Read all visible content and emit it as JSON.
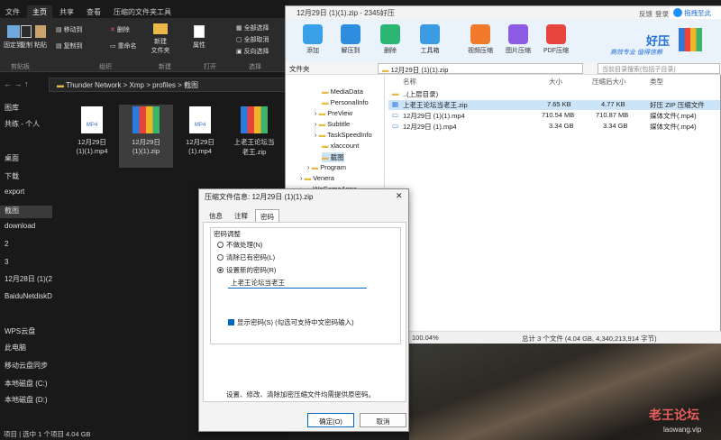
{
  "explorer": {
    "tabs": [
      "文件",
      "主页",
      "共享",
      "查看",
      "压缩的文件夹工具"
    ],
    "ribbon": {
      "btn_pin": "固定到",
      "btn_copy": "复制",
      "btn_paste": "粘贴",
      "move_to": "移动到",
      "copy_to": "复制到",
      "delete": "删除",
      "rename": "重命名",
      "new_folder": "新建\n文件夹",
      "properties": "属性",
      "select_all": "全部选择",
      "select_none": "全部取消",
      "invert": "反向选择",
      "groups": [
        "剪贴板",
        "组织",
        "新建",
        "打开",
        "选择"
      ]
    },
    "address": "Thunder Network  >  Xmp  >  profiles  >  截图",
    "nav": [
      "图库",
      "共练 - 个人",
      "桌面",
      "下载",
      "export",
      "截图",
      "download",
      "2",
      "3",
      "12月28日 (1)(2",
      "BaiduNetdiskD",
      "WPS云盘",
      "此电脑",
      "移动云盘同步",
      "本地磁盘 (C:)",
      "本地磁盘 (D:)"
    ],
    "files": [
      {
        "name": "12月29日\n(1)(1).mp4",
        "type": "MP4"
      },
      {
        "name": "12月29日\n(1)(1).zip",
        "type": "zip"
      },
      {
        "name": "12月29日\n(1).mp4",
        "type": "MP4"
      },
      {
        "name": "上老王论坛当\n老王.zip",
        "type": "zip"
      }
    ],
    "status": "项目  |  选中 1 个项目  4.04 GB"
  },
  "zip": {
    "title": "12月29日 (1)(1).zip - 2345好压",
    "top_links": [
      "反馈",
      "登录"
    ],
    "vip": "拖拽至此",
    "toolbar": [
      "添加",
      "解压到",
      "删除",
      "工具箱",
      "视频压缩",
      "图片压缩",
      "PDF压缩"
    ],
    "brand": "好压",
    "slogan": "高效专业  值得信赖",
    "tree_header": "文件夹",
    "address": "12月29日 (1)(1).zip",
    "search": "当前目录搜索(包括子目录)",
    "tree": [
      "MediaData",
      "PersonalInfo",
      "PreView",
      "Subtitle",
      "TaskSpeedInfo",
      "xlaccount",
      "截图",
      "Program",
      "Venera",
      "WeGameApps"
    ],
    "columns": [
      "名称",
      "大小",
      "压缩后大小",
      "类型"
    ],
    "rows": [
      {
        "name": "..(上层目录)",
        "size": "",
        "csize": "",
        "type": ""
      },
      {
        "name": "上老王论坛当老王.zip",
        "size": "7.65 KB",
        "csize": "4.77 KB",
        "type": "好压 ZIP 压缩文件"
      },
      {
        "name": "12月29日 (1)(1).mp4",
        "size": "710.54 MB",
        "csize": "710.87 MB",
        "type": "媒体文件(.mp4)"
      },
      {
        "name": "12月29日 (1).mp4",
        "size": "3.34 GB",
        "csize": "3.34 GB",
        "type": "媒体文件(.mp4)"
      }
    ],
    "zoom": "100.04%",
    "summary": "总计 3 个文件 (4.04 GB, 4,340,213,914 字节)"
  },
  "dialog": {
    "title": "压缩文件信息: 12月29日 (1)(1).zip",
    "tabs": [
      "信息",
      "注释",
      "密码"
    ],
    "group": "密码调整",
    "opt1": "不做处理(N)",
    "opt2": "清除已有密码(L)",
    "opt3": "设置新的密码(R)",
    "password": "上老王论坛当老王",
    "show": "显示密码(S)   (勾选可支持中文密码输入)",
    "note": "设置、修改、清除加密压缩文件均需提供原密码。",
    "ok": "确定(O)",
    "cancel": "取消"
  },
  "watermark": {
    "name": "老王论坛",
    "url": "laowang.vip"
  }
}
